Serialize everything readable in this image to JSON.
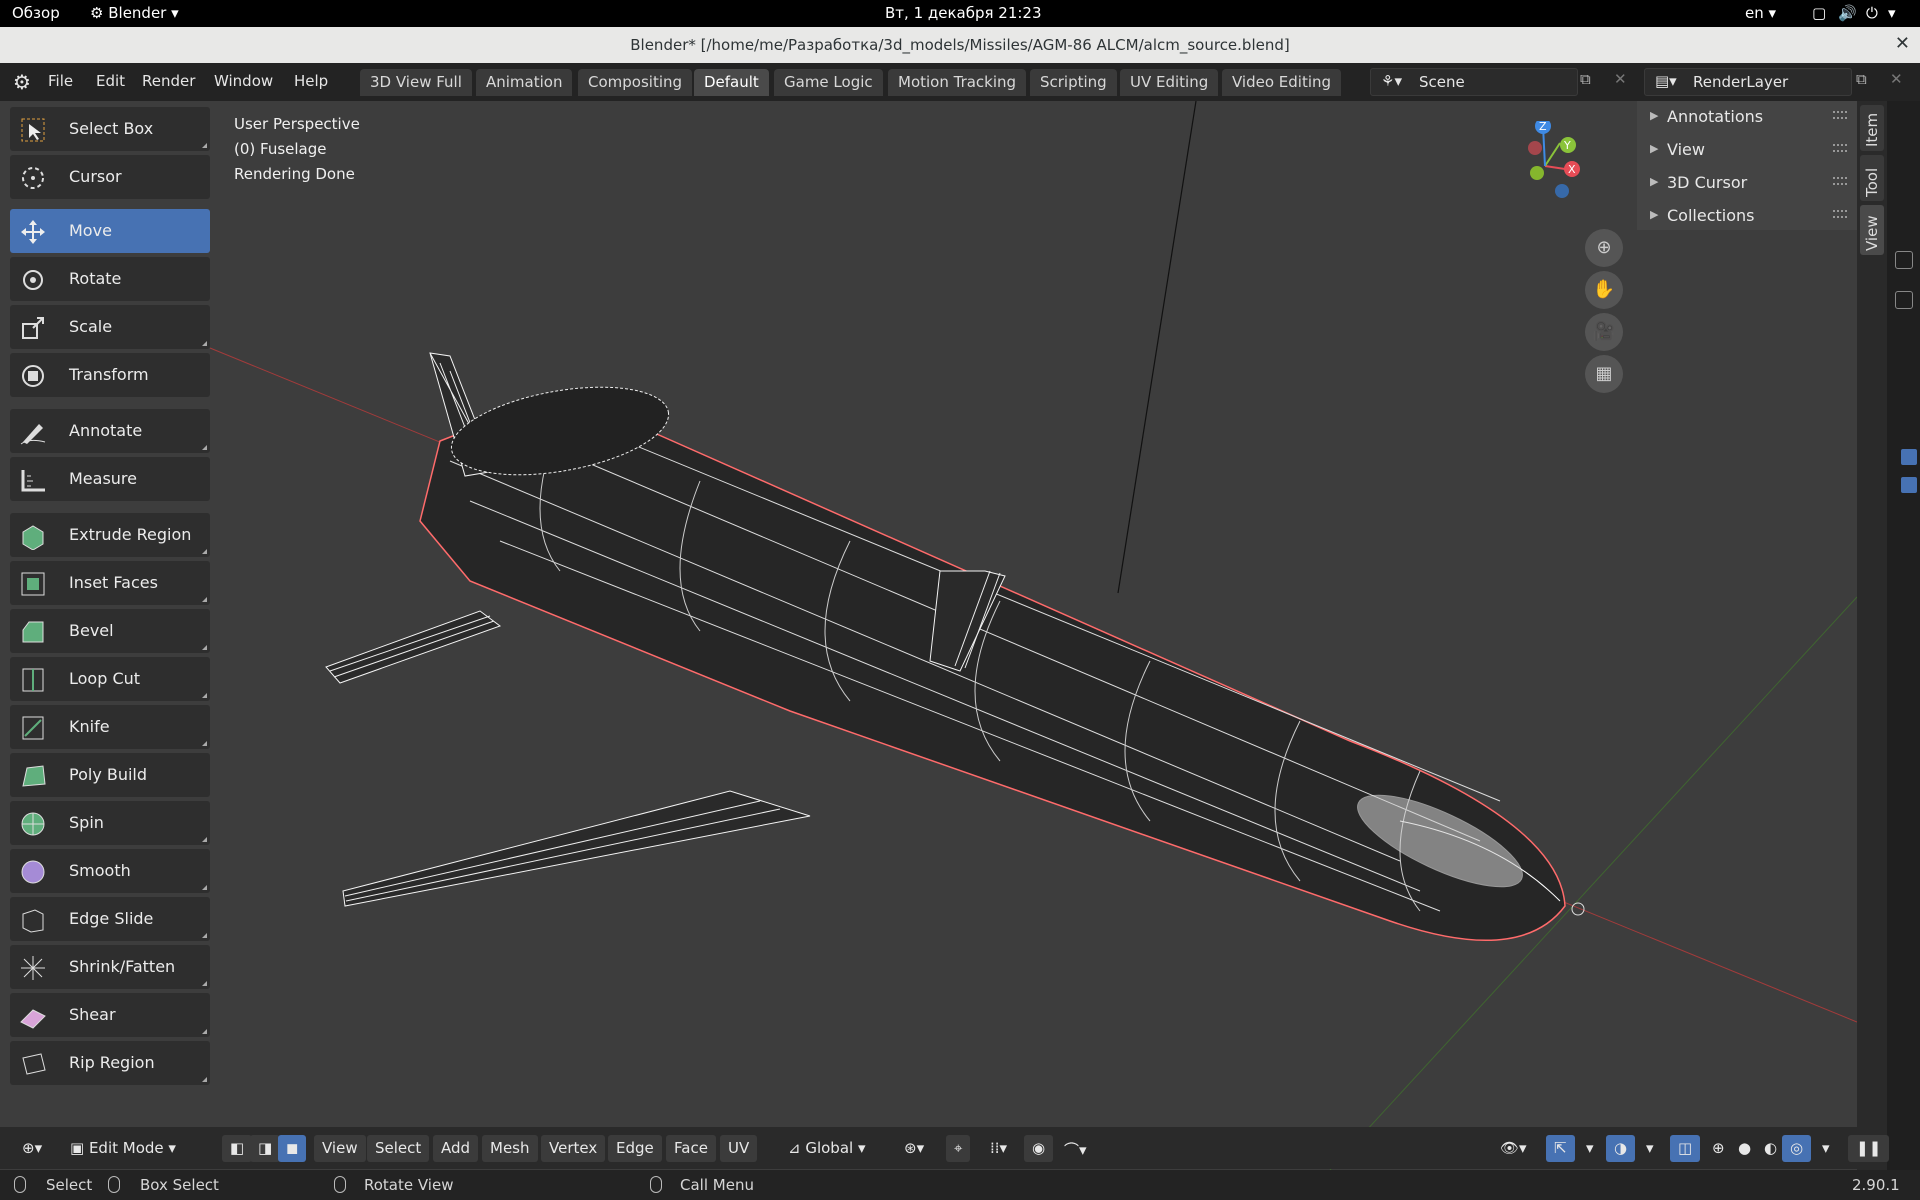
{
  "system": {
    "overview": "Обзор",
    "app": "Blender",
    "datetime": "Вт, 1 декабря  21:23",
    "lang": "en"
  },
  "window": {
    "title": "Blender* [/home/me/Разработка/3d_models/Missiles/AGM-86 ALCM/alcm_source.blend]"
  },
  "menu": [
    "File",
    "Edit",
    "Render",
    "Window",
    "Help"
  ],
  "workspaces": [
    "3D View Full",
    "Animation",
    "Compositing",
    "Default",
    "Game Logic",
    "Motion Tracking",
    "Scripting",
    "UV Editing",
    "Video Editing"
  ],
  "active_workspace": "Default",
  "scene": "Scene",
  "render_layer": "RenderLayer",
  "viewport": {
    "perspective": "User Perspective",
    "object": "(0) Fuselage",
    "status": "Rendering Done"
  },
  "tools": [
    {
      "label": "Select Box",
      "icon": "select-box-icon"
    },
    {
      "label": "Cursor",
      "icon": "cursor-icon"
    },
    {
      "label": "Move",
      "icon": "move-icon"
    },
    {
      "label": "Rotate",
      "icon": "rotate-icon"
    },
    {
      "label": "Scale",
      "icon": "scale-icon"
    },
    {
      "label": "Transform",
      "icon": "transform-icon"
    },
    {
      "label": "Annotate",
      "icon": "annotate-icon"
    },
    {
      "label": "Measure",
      "icon": "measure-icon"
    },
    {
      "label": "Extrude Region",
      "icon": "extrude-icon"
    },
    {
      "label": "Inset Faces",
      "icon": "inset-icon"
    },
    {
      "label": "Bevel",
      "icon": "bevel-icon"
    },
    {
      "label": "Loop Cut",
      "icon": "loop-cut-icon"
    },
    {
      "label": "Knife",
      "icon": "knife-icon"
    },
    {
      "label": "Poly Build",
      "icon": "poly-build-icon"
    },
    {
      "label": "Spin",
      "icon": "spin-icon"
    },
    {
      "label": "Smooth",
      "icon": "smooth-icon"
    },
    {
      "label": "Edge Slide",
      "icon": "edge-slide-icon"
    },
    {
      "label": "Shrink/Fatten",
      "icon": "shrink-fatten-icon"
    },
    {
      "label": "Shear",
      "icon": "shear-icon"
    },
    {
      "label": "Rip Region",
      "icon": "rip-region-icon"
    }
  ],
  "active_tool": "Move",
  "npanel": {
    "sections": [
      "Annotations",
      "View",
      "3D Cursor",
      "Collections"
    ],
    "tabs": [
      "Item",
      "Tool",
      "View"
    ]
  },
  "gizmo": {
    "z": "Z",
    "y": "Y",
    "x": "X"
  },
  "header": {
    "mode": "Edit Mode",
    "menus": [
      "View",
      "Select",
      "Add",
      "Mesh",
      "Vertex",
      "Edge",
      "Face",
      "UV"
    ],
    "orientation": "Global"
  },
  "statusbar": {
    "select": "Select",
    "box_select": "Box Select",
    "rotate_view": "Rotate View",
    "call_menu": "Call Menu",
    "version": "2.90.1"
  },
  "colors": {
    "accent": "#4772b3",
    "x_axis": "#e64c56",
    "y_axis": "#8ac33a",
    "z_axis": "#3f8ae4"
  }
}
